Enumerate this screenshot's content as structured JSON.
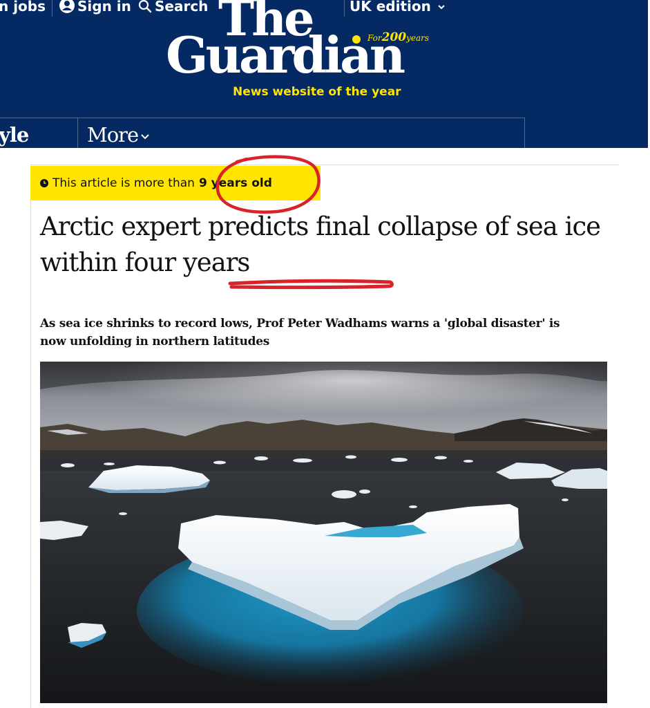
{
  "masthead": {
    "topbar": {
      "jobs_label": "n jobs",
      "signin_label": "Sign in",
      "search_label": "Search",
      "edition_label": "UK edition"
    },
    "logo": {
      "the": "The",
      "guardian": "Guardian",
      "for_prefix": "For",
      "for_number": "200",
      "for_suffix": "years"
    },
    "tagline": "News website of the year",
    "nav": {
      "style_label": "yle",
      "more_label": "More"
    }
  },
  "article": {
    "age_banner": {
      "prefix": "This article is more than",
      "value": "9 years old"
    },
    "headline_part1": "Arctic expert predicts final collapse of sea ice within ",
    "headline_part2": "four years",
    "standfirst": "As sea ice shrinks to record lows, Prof Peter Wadhams warns a 'global disaster' is now unfolding in northern latitudes"
  },
  "colors": {
    "masthead_bg": "#052962",
    "accent_yellow": "#ffe500",
    "annotation_red": "#d8232a",
    "text": "#121212"
  }
}
